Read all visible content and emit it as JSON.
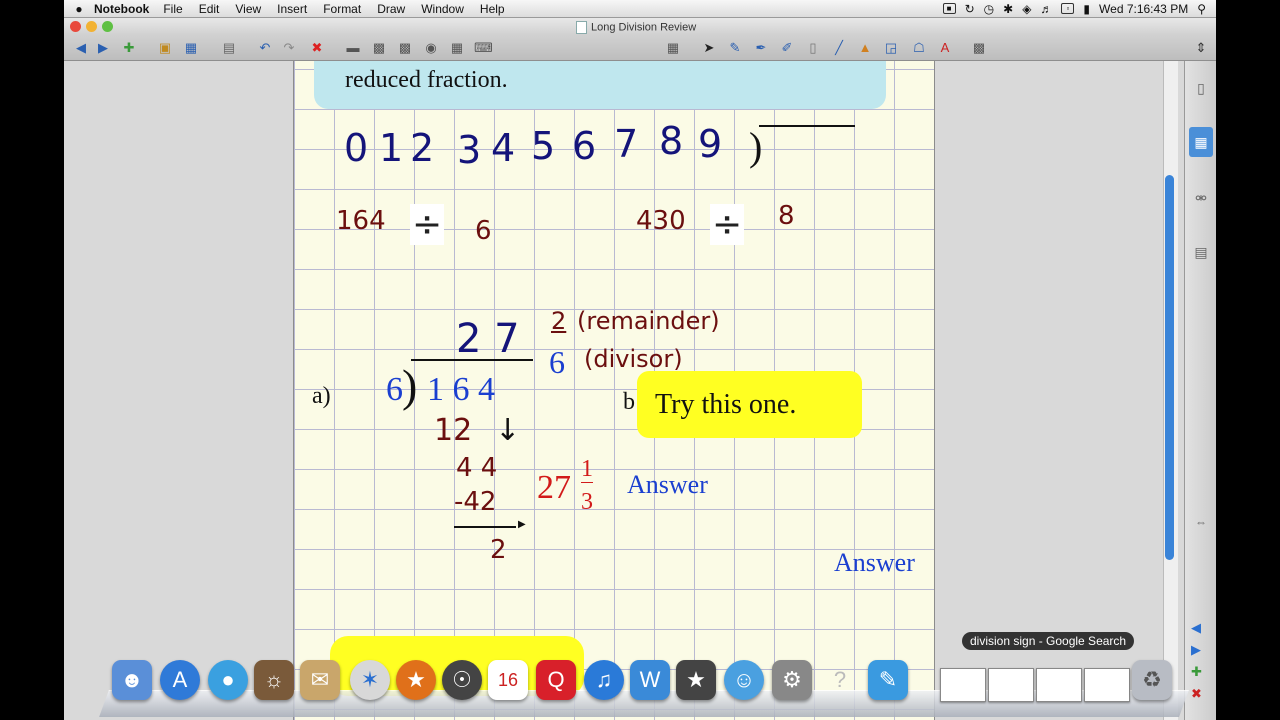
{
  "menubar": {
    "app_name": "Notebook",
    "menus": [
      "File",
      "Edit",
      "View",
      "Insert",
      "Format",
      "Draw",
      "Window",
      "Help"
    ],
    "clock": "Wed 7:16:43 PM"
  },
  "window": {
    "title": "Long Division Review"
  },
  "canvas": {
    "banner_text": "reduced fraction.",
    "digits": [
      "0",
      "1",
      "2",
      "3",
      "4",
      "5",
      "6",
      "7",
      "8",
      "9"
    ],
    "digits_bracket": ")",
    "problem1_dividend": "164",
    "problem1_divisor": "6",
    "problem2_dividend": "430",
    "problem2_divisor": "8",
    "division_sign": "÷",
    "quotient": "2 7",
    "remainder_num": "2",
    "remainder_label": "(remainder)",
    "remainder_den": "6",
    "divisor_label": "(divisor)",
    "label_a": "a)",
    "label_b": "b",
    "work_divisor": "6",
    "work_bracket": ")",
    "work_dividend": "1 6 4",
    "step1": "12",
    "step1_arrow": "↓",
    "step2": "4  4",
    "step3": "-42",
    "step4": "2",
    "mixed_whole": "27",
    "mixed_num": "1",
    "mixed_den": "3",
    "answer_a": "Answer",
    "answer_b": "Answer",
    "try_text": "Try this one."
  },
  "dock": {
    "tooltip": "division sign - Google Search",
    "calendar_day": "16"
  }
}
